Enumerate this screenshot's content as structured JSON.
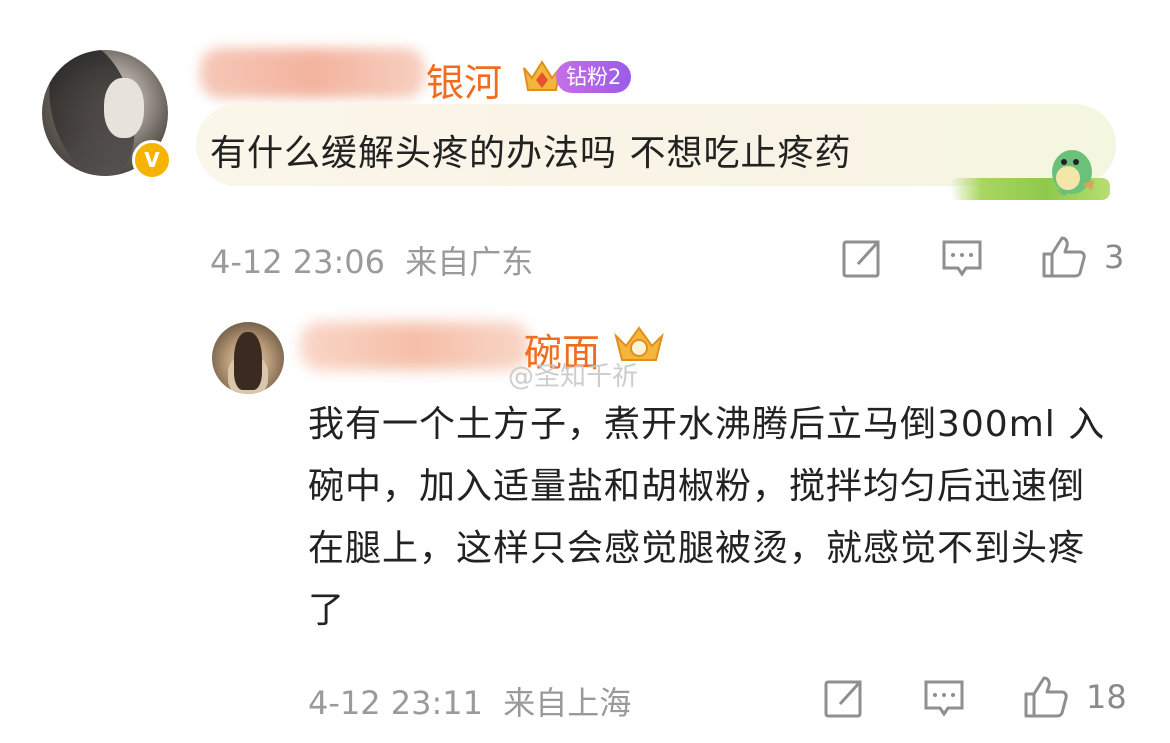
{
  "comment": {
    "user_name_visible": "银河",
    "fan_badge": "钻粉2",
    "text": "有什么缓解头疼的办法吗 不想吃止疼药",
    "verified_badge": "V",
    "time": "4-12 23:06",
    "location": "来自广东",
    "like_count": "3"
  },
  "reply": {
    "user_name_visible": "碗面",
    "text": "我有一个土方子，煮开水沸腾后立马倒300ml 入碗中，加入适量盐和胡椒粉，搅拌均匀后迅速倒在腿上，这样只会感觉腿被烫，就感觉不到头疼了",
    "time": "4-12 23:11",
    "location": "来自上海",
    "like_count": "18"
  },
  "watermark": "@圣知千祈",
  "icons": {
    "share": "share-icon",
    "reply": "comment-icon",
    "like": "thumbs-up-icon",
    "crown": "crown-icon"
  },
  "colors": {
    "name": "#f26c1d",
    "meta": "#9a9a9a",
    "badge": "#b366e8",
    "vip": "#f5b400"
  }
}
